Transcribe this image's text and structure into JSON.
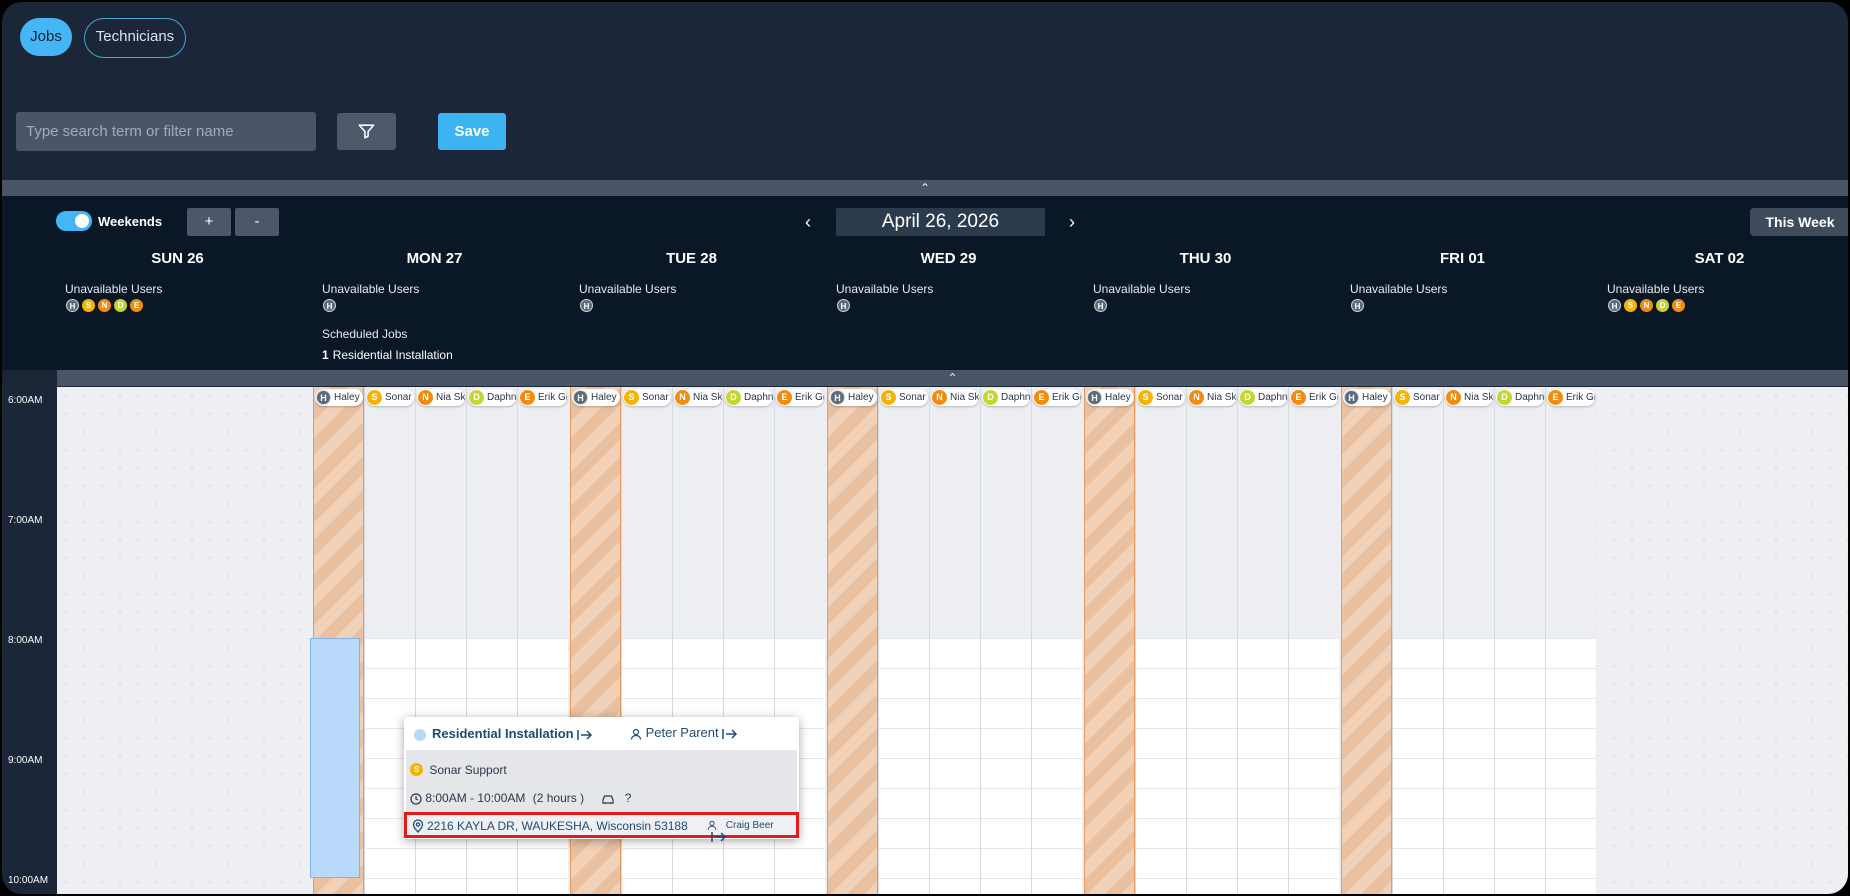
{
  "tabs": {
    "jobs": "Jobs",
    "technicians": "Technicians"
  },
  "search": {
    "placeholder": "Type search term or filter name",
    "value": ""
  },
  "toolbar": {
    "save_label": "Save",
    "filter_icon": "filter-icon"
  },
  "collapse_symbol": "⌃",
  "calendar": {
    "weekends_label": "Weekends",
    "weekends_on": true,
    "zoom_in": "+",
    "zoom_out": "-",
    "prev": "‹",
    "next": "›",
    "current_date": "April 26, 2026",
    "this_week": "This Week",
    "unavailable_label": "Unavailable Users",
    "scheduled_label": "Scheduled Jobs",
    "scheduled_count": "1",
    "scheduled_name": "Residential Installation",
    "days": [
      {
        "label": "SUN 26",
        "unavailable": [
          "H",
          "S",
          "N",
          "D",
          "E"
        ]
      },
      {
        "label": "MON 27",
        "unavailable": [
          "H"
        ]
      },
      {
        "label": "TUE 28",
        "unavailable": [
          "H"
        ]
      },
      {
        "label": "WED 29",
        "unavailable": [
          "H"
        ]
      },
      {
        "label": "THU 30",
        "unavailable": [
          "H"
        ]
      },
      {
        "label": "FRI 01",
        "unavailable": [
          "H"
        ]
      },
      {
        "label": "SAT 02",
        "unavailable": [
          "H",
          "S",
          "N",
          "D",
          "E"
        ]
      }
    ],
    "times": [
      "6:00AM",
      "7:00AM",
      "8:00AM",
      "9:00AM",
      "10:00AM"
    ],
    "lanes": [
      {
        "initial": "H",
        "name": "Haley",
        "color": "#5b6b7a"
      },
      {
        "initial": "S",
        "name": "Sonar",
        "color": "#f4b400"
      },
      {
        "initial": "N",
        "name": "Nia Sk",
        "color": "#f28c0f"
      },
      {
        "initial": "D",
        "name": "Daphn",
        "color": "#c5d531"
      },
      {
        "initial": "E",
        "name": "Erik Gr",
        "color": "#f28c0f"
      }
    ]
  },
  "avatar_colors": {
    "H": "#5b6b7a",
    "S": "#f4b400",
    "N": "#f28c0f",
    "D": "#c5d531",
    "E": "#f28c0f"
  },
  "popup": {
    "job_title": "Residential Installation",
    "customer": "Peter Parent",
    "tech_initial": "S",
    "tech_name": "Sonar Support",
    "time_range": "8:00AM - 10:00AM",
    "duration": "(2 hours )",
    "vehicle": "?",
    "address": "2216 KAYLA DR, WAUKESHA, Wisconsin 53188",
    "assignee": "Craig Beer"
  }
}
